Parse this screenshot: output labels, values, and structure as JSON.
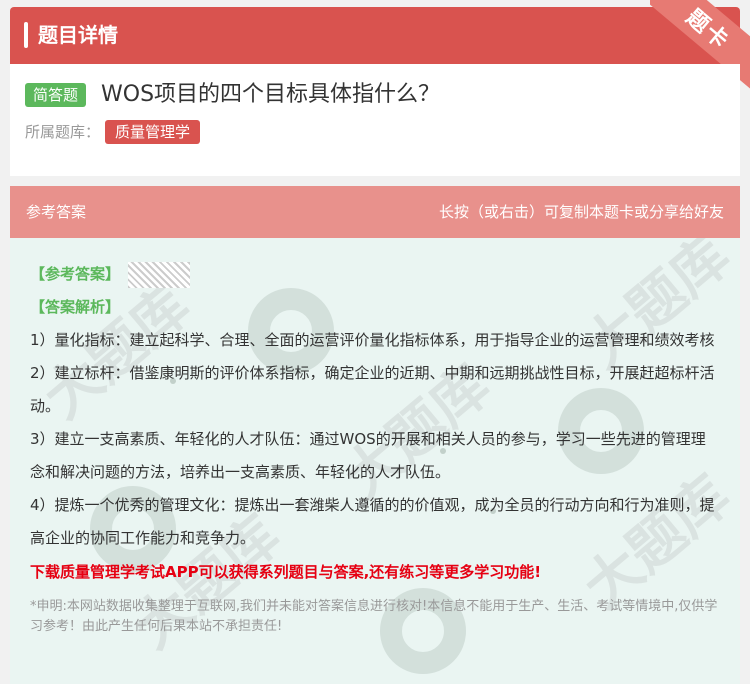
{
  "header": {
    "title": "题目详情",
    "corner_label": "题卡"
  },
  "question": {
    "type_tag": "简答题",
    "title": "WOS项目的四个目标具体指什么？",
    "bank_label": "所属题库：",
    "bank_name": "质量管理学"
  },
  "answer_bar": {
    "left": "参考答案",
    "right": "长按（或右击）可复制本题卡或分享给好友"
  },
  "answer": {
    "ref_label": "【参考答案】",
    "analysis_label": "【答案解析】",
    "paragraphs": [
      "1）量化指标：建立起科学、合理、全面的运营评价量化指标体系，用于指导企业的运营管理和绩效考核",
      "2）建立标杆：借鉴康明斯的评价体系指标，确定企业的近期、中期和远期挑战性目标，开展赶超标杆活动。",
      "3）建立一支高素质、年轻化的人才队伍：通过WOS的开展和相关人员的参与，学习一些先进的管理理念和解决问题的方法，培养出一支高素质、年轻化的人才队伍。",
      "4）提炼一个优秀的管理文化：提炼出一套潍柴人遵循的的价值观，成为全员的行动方向和行为准则，提高企业的协同工作能力和竞争力。"
    ],
    "promo": "下载质量管理学考试APP可以获得系列题目与答案,还有练习等更多学习功能!",
    "note": "*申明:本网站数据收集整理于互联网,我们并未能对答案信息进行核对!本信息不能用于生产、生活、考试等情境中,仅供学习参考！由此产生任何后果本站不承担责任!"
  },
  "watermark": {
    "text": "大题库"
  },
  "colors": {
    "header": "#d9534f",
    "tag_green": "#5cb85c",
    "answer_bar": "#e8918c",
    "promo": "#e60012"
  }
}
